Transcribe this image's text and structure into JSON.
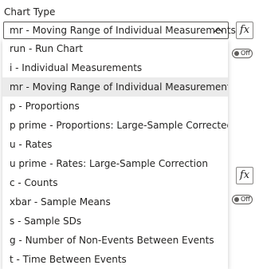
{
  "section_label": "Chart Type",
  "select": {
    "value": "mr - Moving Range of Individual Measurements",
    "chevron_icon": "chevron-up-icon"
  },
  "fx_button_label": "fx",
  "toggle_label": "Off",
  "options": [
    "run - Run Chart",
    "i - Individual Measurements",
    "mr - Moving Range of Individual Measurements",
    "p - Proportions",
    "p prime - Proportions: Large-Sample Corrected",
    "u - Rates",
    "u prime - Rates: Large-Sample Correction",
    "c - Counts",
    "xbar - Sample Means",
    "s - Sample SDs",
    "g - Number of Non-Events Between Events",
    "t - Time Between Events"
  ],
  "selected_option_index": 2,
  "colors": {
    "selected_background": "#ebebeb",
    "text": "#252423",
    "border": "#605e5c"
  }
}
